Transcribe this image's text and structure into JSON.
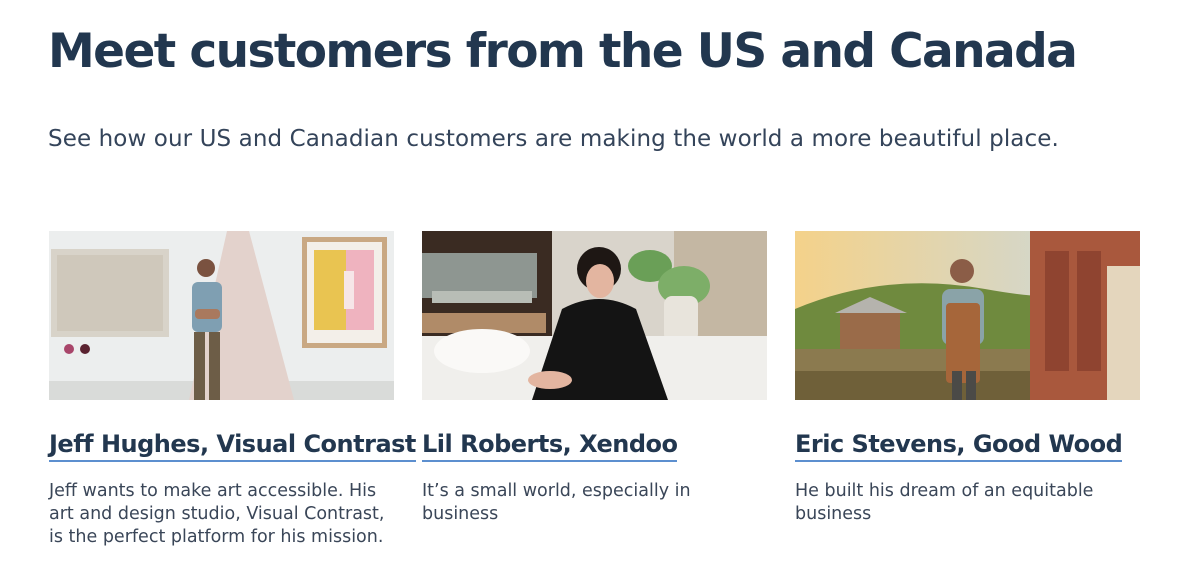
{
  "page": {
    "headline": "Meet customers from the US and Canada",
    "subhead": "See how our US and Canadian customers are making the world a more beautiful place."
  },
  "cards": [
    {
      "title": "Jeff Hughes, Visual Contrast",
      "description": "Jeff wants to make art accessible. His art and design studio, Visual Contrast, is the perfect platform for his mission.",
      "image": "photo-of-man-in-art-studio"
    },
    {
      "title": "Lil Roberts, Xendoo",
      "description": "It’s a small world, especially in business",
      "image": "photo-of-smiling-woman-on-sofa"
    },
    {
      "title": "Eric Stevens, Good Wood",
      "description": "He built his dream of an equitable business",
      "image": "photo-of-man-in-apron-by-barn"
    }
  ],
  "colors": {
    "heading": "#22374f",
    "link_underline": "#5c8fcf",
    "body_text": "#3a4658"
  }
}
